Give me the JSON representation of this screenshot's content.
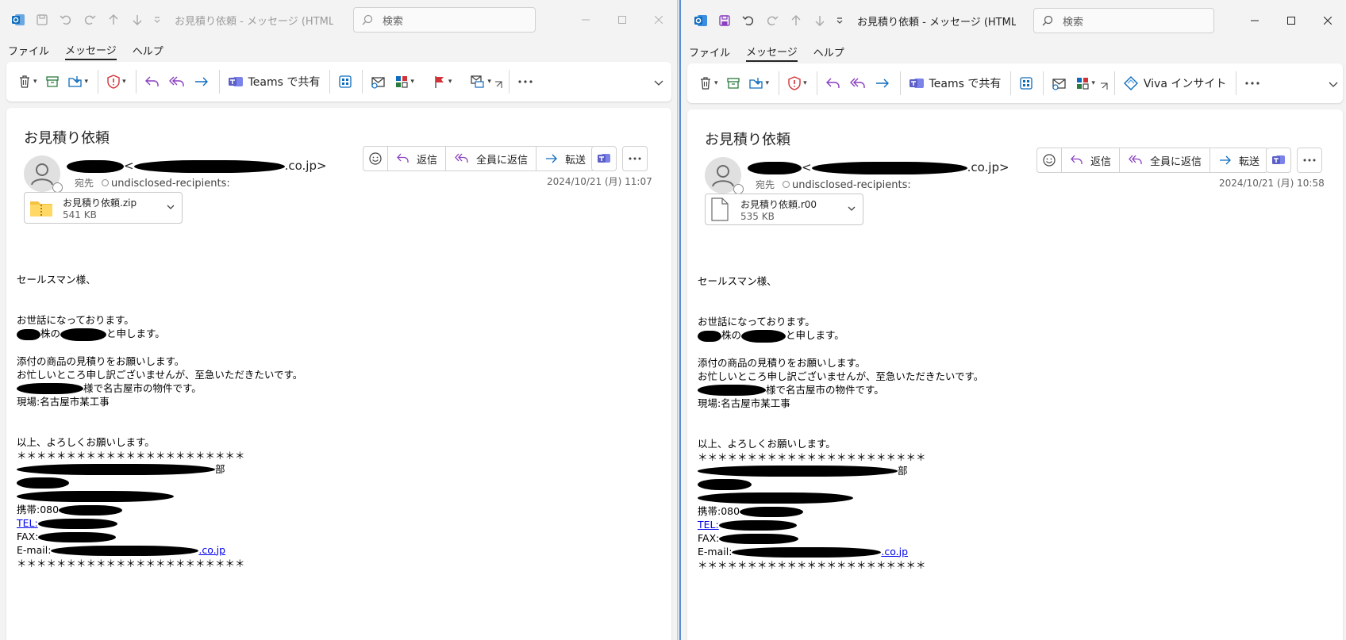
{
  "windows": [
    {
      "id": "left",
      "active": false,
      "title": "お見積り依頼  -  メッセージ (HTML…",
      "search_placeholder": "検索",
      "menu": [
        "ファイル",
        "メッセージ",
        "ヘルプ"
      ],
      "ribbon": {
        "teams_label": "Teams で共有",
        "viva_label": ""
      },
      "email": {
        "subject": "お見積り依頼",
        "sender_suffix": ".co.jp>",
        "to_label": "宛先",
        "recipients": "undisclosed-recipients:",
        "date": "2024/10/21 (月) 11:07",
        "actions": {
          "reply": "返信",
          "reply_all": "全員に返信",
          "forward": "転送"
        },
        "attachment": {
          "name": "お見積り依頼.zip",
          "size": "541 KB",
          "type": "zip"
        },
        "body": {
          "greeting": "セールスマン様、",
          "line1": "お世話になっております。",
          "line2_a": "株の",
          "line2_b": "と申します。",
          "line3": "添付の商品の見積りをお願いします。",
          "line4": "お忙しいところ申し訳ございませんが、至急いただきたいです。",
          "line5": "様で名古屋市の物件です。",
          "line6": "現場:名古屋市某工事",
          "line7": "以上、よろしくお願いします。",
          "stars": "＊＊＊＊＊＊＊＊＊＊＊＊＊＊＊＊＊＊＊＊＊＊＊",
          "dept_suffix": "部",
          "mobile_label": "携帯:080",
          "tel_label": "TEL:",
          "fax_label": "FAX:",
          "email_label": "E-mail:",
          "email_suffix": ".co.jp"
        }
      }
    },
    {
      "id": "right",
      "active": true,
      "title": "お見積り依頼  -  メッセージ (HTML…",
      "search_placeholder": "検索",
      "menu": [
        "ファイル",
        "メッセージ",
        "ヘルプ"
      ],
      "ribbon": {
        "teams_label": "Teams で共有",
        "viva_label": "Viva インサイト"
      },
      "email": {
        "subject": "お見積り依頼",
        "sender_suffix": ".co.jp>",
        "to_label": "宛先",
        "recipients": "undisclosed-recipients:",
        "date": "2024/10/21 (月) 10:58",
        "actions": {
          "reply": "返信",
          "reply_all": "全員に返信",
          "forward": "転送"
        },
        "attachment": {
          "name": "お見積り依頼.r00",
          "size": "535 KB",
          "type": "file"
        },
        "body": {
          "greeting": "セールスマン様、",
          "line1": "お世話になっております。",
          "line2_a": "株の",
          "line2_b": "と申します。",
          "line3": "添付の商品の見積りをお願いします。",
          "line4": "お忙しいところ申し訳ございませんが、至急いただきたいです。",
          "line5": "様で名古屋市の物件です。",
          "line6": "現場:名古屋市某工事",
          "line7": "以上、よろしくお願いします。",
          "stars": "＊＊＊＊＊＊＊＊＊＊＊＊＊＊＊＊＊＊＊＊＊＊＊",
          "dept_suffix": "部",
          "mobile_label": "携帯:080",
          "tel_label": "TEL:",
          "fax_label": "FAX:",
          "email_label": "E-mail:",
          "email_suffix": ".co.jp"
        }
      }
    }
  ],
  "colors": {
    "outlook_blue": "#0f6cbd",
    "teams_purple": "#5b5fc7",
    "link_blue": "#0000ee",
    "security_red": "#d13438",
    "reply_purple": "#8a3fbf",
    "forward_blue": "#0f6cbd"
  }
}
